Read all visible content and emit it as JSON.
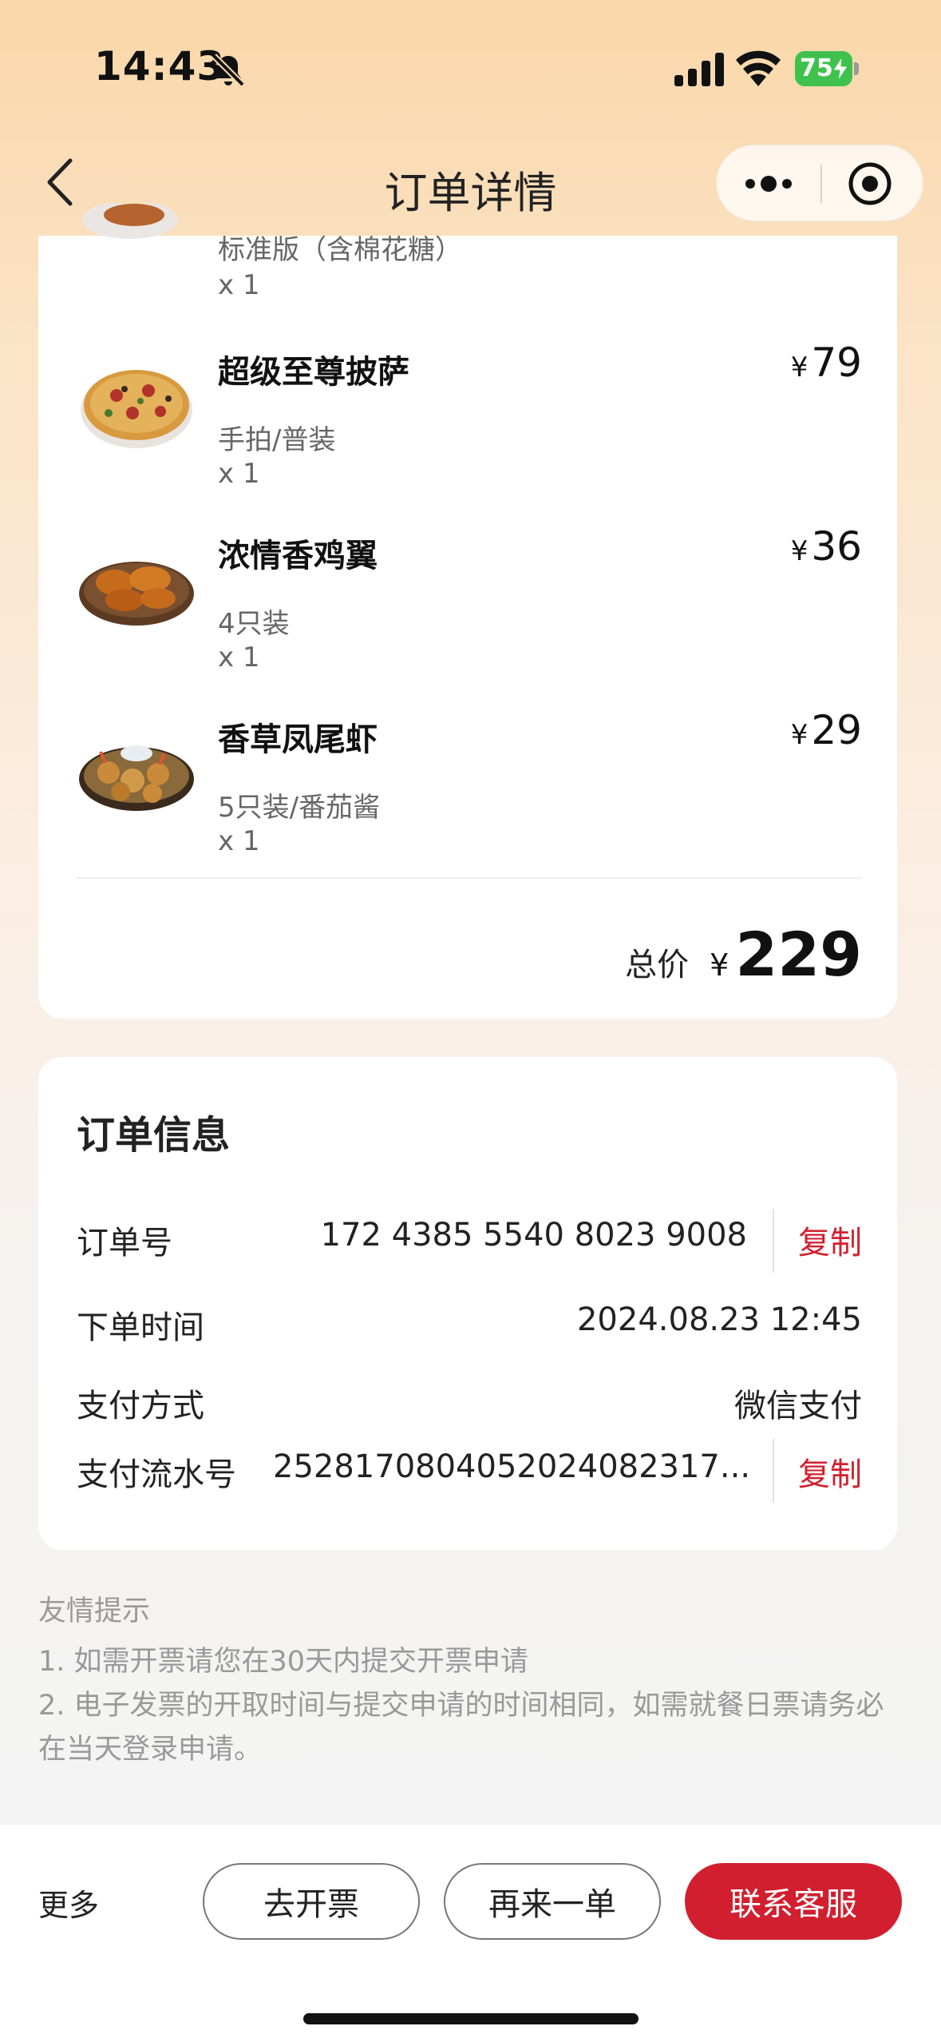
{
  "status_bar": {
    "time": "14:43",
    "battery": "75"
  },
  "nav": {
    "title": "订单详情"
  },
  "order_items": {
    "partial_item": {
      "variant": "标准版（含棉花糖）",
      "qty": "x 1"
    },
    "items": [
      {
        "name": "超级至尊披萨",
        "variant": "手拍/普装",
        "qty": "x 1",
        "currency": "¥",
        "price": "79",
        "icon": "pizza-image"
      },
      {
        "name": "浓情香鸡翼",
        "variant": "4只装",
        "qty": "x 1",
        "currency": "¥",
        "price": "36",
        "icon": "chicken-wings-image"
      },
      {
        "name": "香草凤尾虾",
        "variant": "5只装/番茄酱",
        "qty": "x 1",
        "currency": "¥",
        "price": "29",
        "icon": "fried-shrimp-image"
      }
    ],
    "total": {
      "label": "总价",
      "currency": "¥",
      "value": "229"
    }
  },
  "order_info": {
    "title": "订单信息",
    "order_no": {
      "label": "订单号",
      "value": "172 4385 5540 8023 9008",
      "copy": "复制"
    },
    "order_time": {
      "label": "下单时间",
      "value": "2024.08.23 12:45"
    },
    "pay_method": {
      "label": "支付方式",
      "value": "微信支付"
    },
    "pay_serial": {
      "label": "支付流水号",
      "value": "2528170804052024082317...",
      "copy": "复制"
    }
  },
  "tips": {
    "title": "友情提示",
    "line1": "1. 如需开票请您在30天内提交开票申请",
    "line2": "2. 电子发票的开取时间与提交申请的时间相同，如需就餐日票请务必在当天登录申请。"
  },
  "bottom_bar": {
    "more": "更多",
    "invoice": "去开票",
    "reorder": "再来一单",
    "contact": "联系客服"
  },
  "colors": {
    "accent": "#d21f2f",
    "battery": "#3fc24d"
  }
}
